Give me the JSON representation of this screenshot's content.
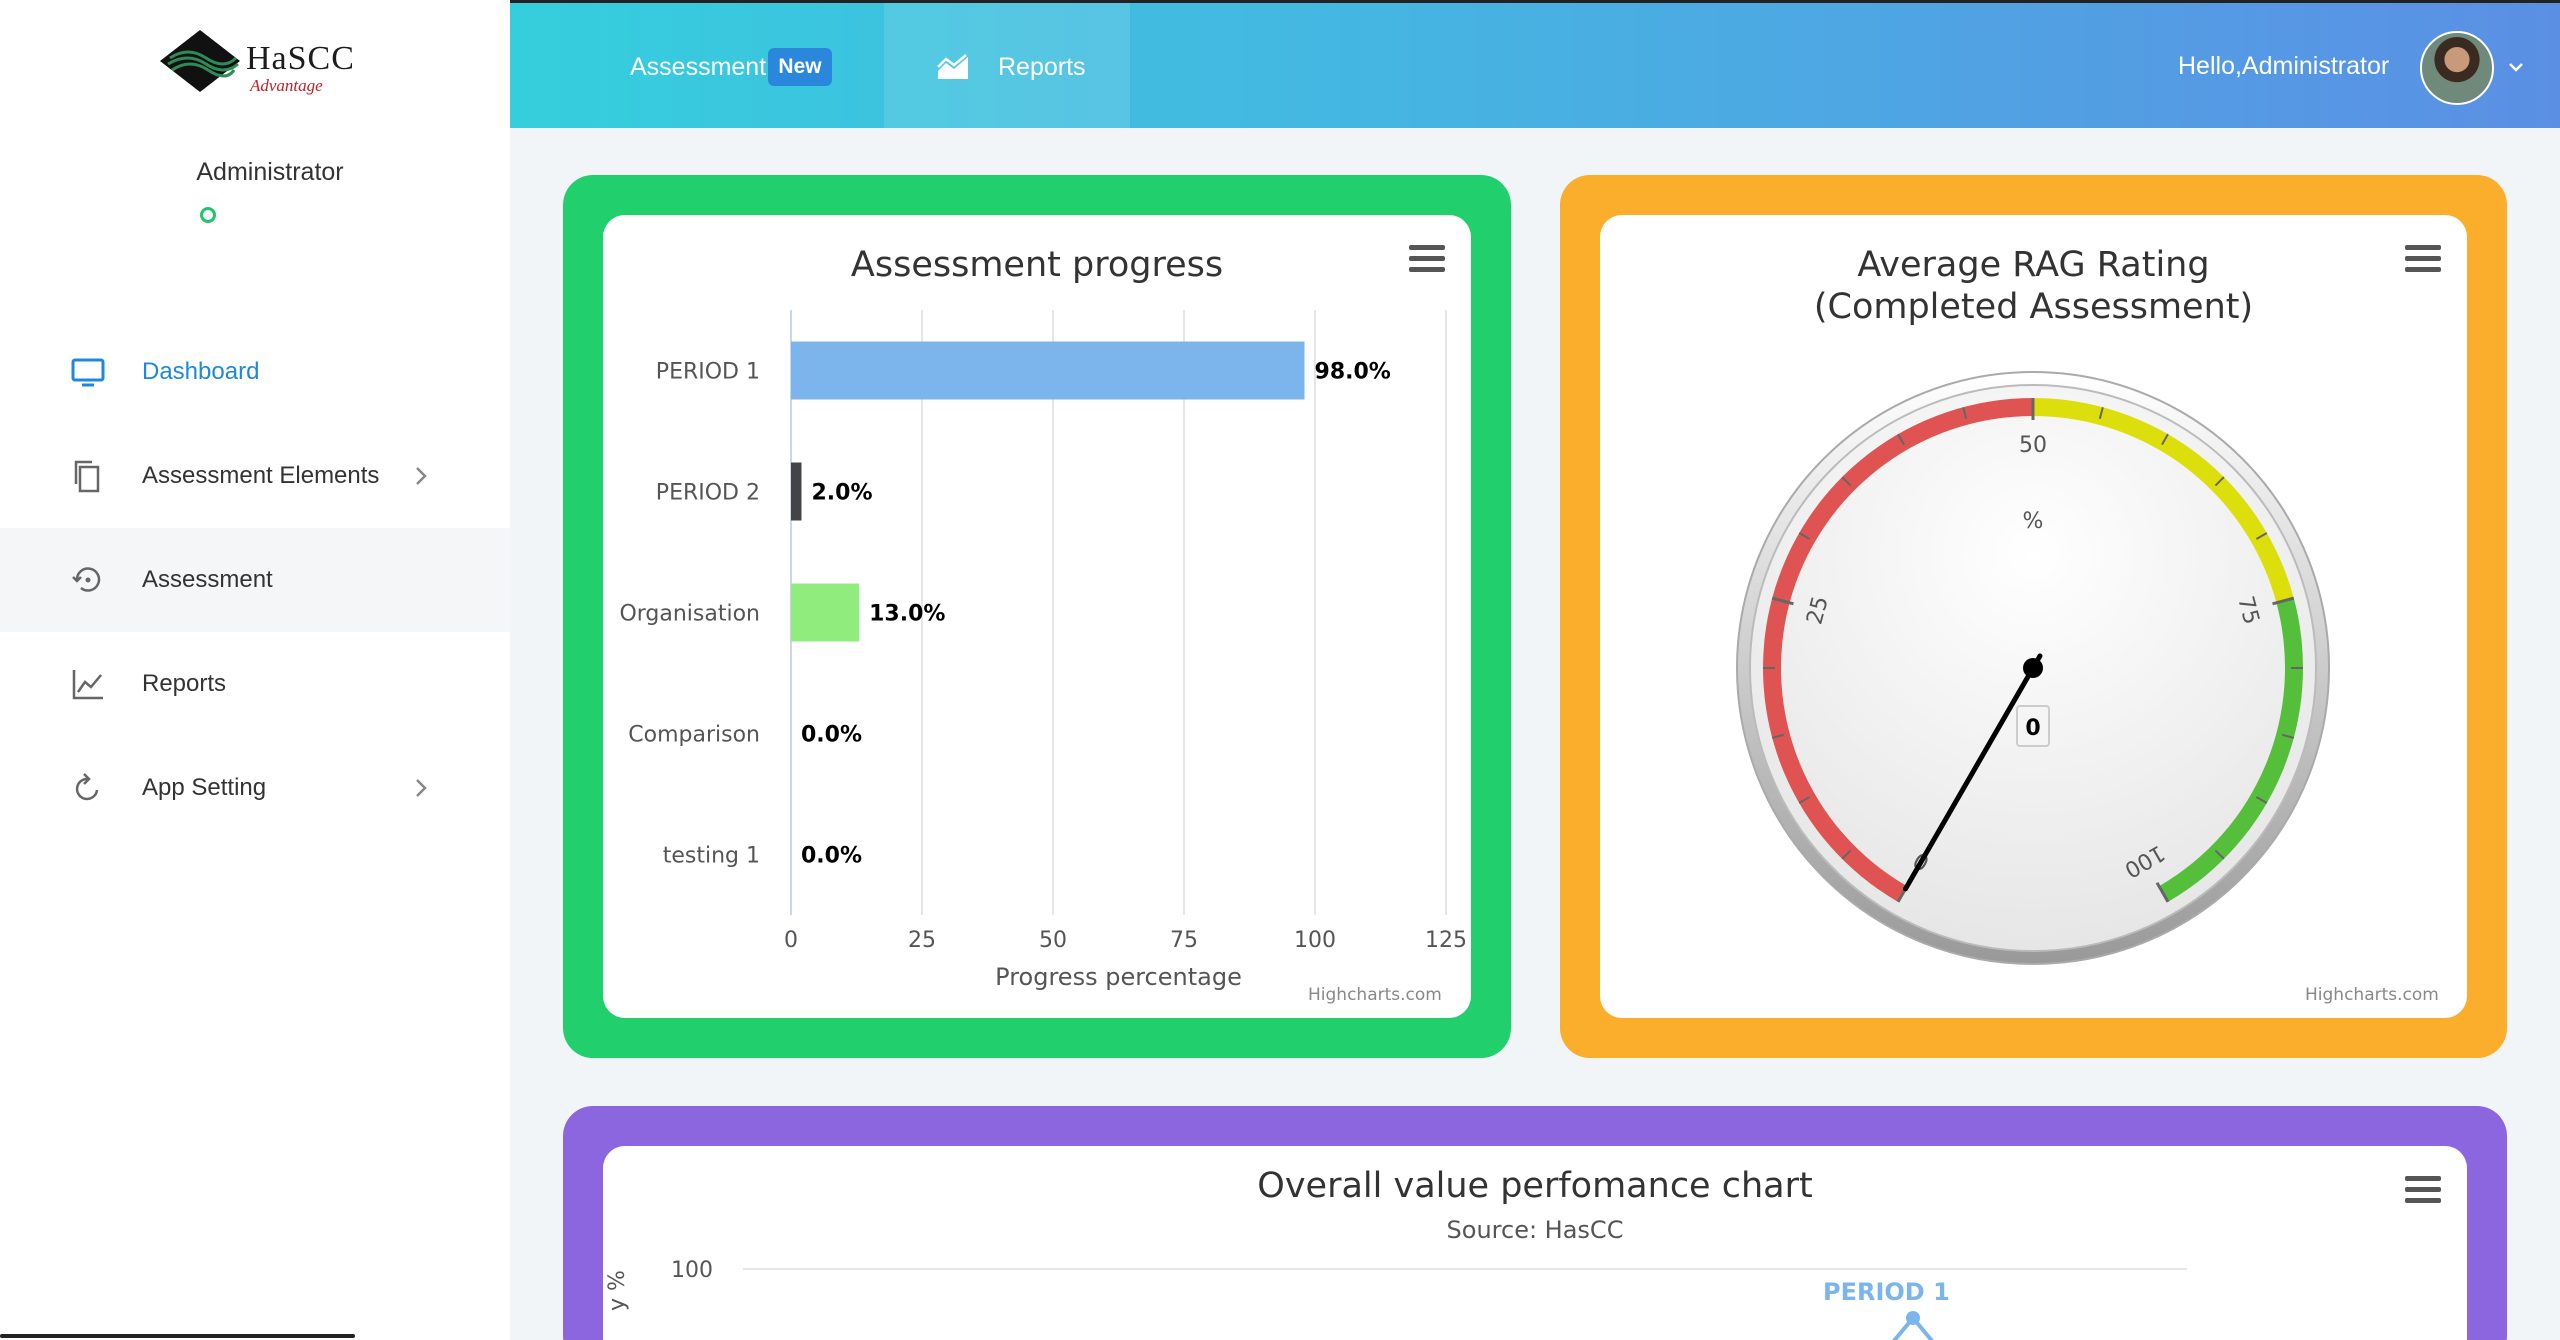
{
  "brand": {
    "name": "HaSCC",
    "tagline": "Advantage"
  },
  "sidebar": {
    "user": {
      "name": "Administrator"
    },
    "items": [
      {
        "label": "Dashboard",
        "icon": "monitor-icon",
        "active": true
      },
      {
        "label": "Assessment Elements",
        "icon": "copy-icon",
        "has_submenu": true
      },
      {
        "label": "Assessment",
        "icon": "history-icon",
        "highlighted": true
      },
      {
        "label": "Reports",
        "icon": "line-chart-icon"
      },
      {
        "label": "App Setting",
        "icon": "refresh-icon",
        "has_submenu": true
      }
    ]
  },
  "header": {
    "tabs": [
      {
        "label": "Assessment",
        "badge": "New"
      },
      {
        "label": "Reports",
        "icon": "area-chart-icon"
      }
    ],
    "greeting": "Hello,Administrator"
  },
  "cards": {
    "progress": {
      "accent": "#21cf6c",
      "credits": "Highcharts.com"
    },
    "rag": {
      "accent": "#fbad2c",
      "credits": "Highcharts.com"
    },
    "performance": {
      "accent": "#8c66de"
    }
  },
  "chart_data": [
    {
      "type": "bar",
      "title": "Assessment progress",
      "xlabel": "Progress percentage",
      "categories": [
        "PERIOD 1",
        "PERIOD 2",
        "Organisation",
        "Comparison",
        "testing 1"
      ],
      "values": [
        98.0,
        2.0,
        13.0,
        0.0,
        0.0
      ],
      "data_labels": [
        "98.0%",
        "2.0%",
        "13.0%",
        "0.0%",
        "0.0%"
      ],
      "colors": [
        "#7cb5ec",
        "#434348",
        "#90ed7d",
        "#f7a35c",
        "#8085e9"
      ],
      "xlim": [
        0,
        125
      ],
      "ticks": [
        0,
        25,
        50,
        75,
        100,
        125
      ],
      "grid": true
    },
    {
      "type": "gauge",
      "title": "Average RAG Rating",
      "subtitle_line": "(Completed Assessment)",
      "unit": "%",
      "value": 0,
      "range": [
        0,
        100
      ],
      "tick_labels": [
        "0",
        "25",
        "50",
        "75",
        "100"
      ],
      "bands": [
        {
          "from": 0,
          "to": 50,
          "color": "#df5353"
        },
        {
          "from": 50,
          "to": 75,
          "color": "#dddf0d"
        },
        {
          "from": 75,
          "to": 100,
          "color": "#55bf3b"
        }
      ]
    },
    {
      "type": "line",
      "title": "Overall value perfomance chart",
      "subtitle": "Source: HasCC",
      "ylabel_visible": "y %",
      "y_tick_visible": "100",
      "point_label": "PERIOD 1",
      "series_color": "#7cb5ec"
    }
  ]
}
